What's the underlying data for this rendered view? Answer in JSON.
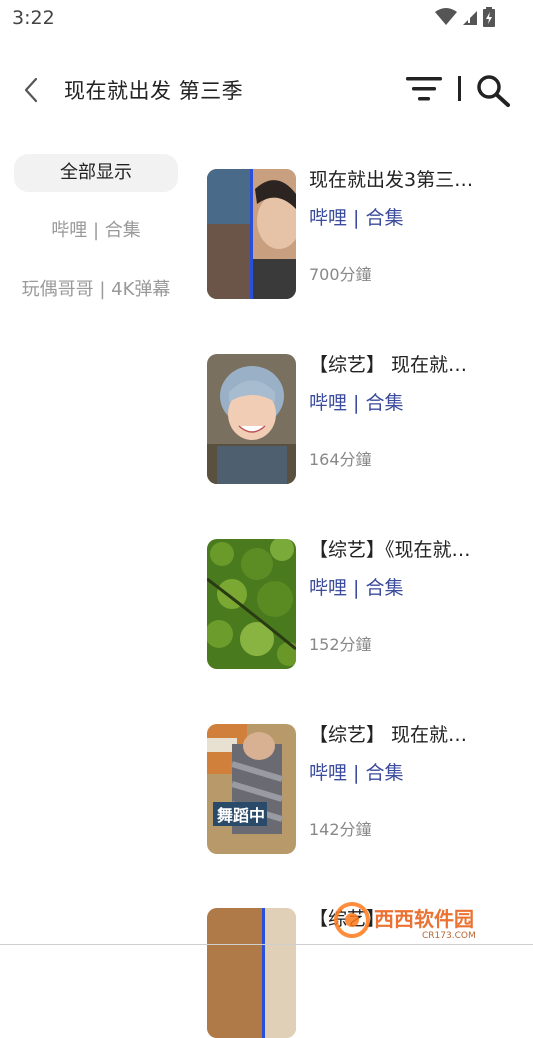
{
  "status": {
    "time": "3:22"
  },
  "header": {
    "title": "现在就出发 第三季"
  },
  "sidebar": {
    "items": [
      {
        "label": "全部显示",
        "active": true
      },
      {
        "label": "哔哩 | 合集",
        "active": false
      },
      {
        "label": "玩偶哥哥 | 4K弹幕",
        "active": false
      }
    ]
  },
  "results": [
    {
      "title": "现在就出发3第三…",
      "source": "哔哩 | 合集",
      "duration": "700分鐘"
    },
    {
      "title": "【综艺】 现在就…",
      "source": "哔哩 | 合集",
      "duration": "164分鐘"
    },
    {
      "title": "【综艺】《现在就…",
      "source": "哔哩 | 合集",
      "duration": "152分鐘"
    },
    {
      "title": "【综艺】 现在就…",
      "source": "哔哩 | 合集",
      "duration": "142分鐘"
    },
    {
      "title": "【综艺】",
      "source": "",
      "duration": ""
    }
  ],
  "thumb_texts": {
    "dance_caption": "舞蹈中"
  },
  "watermark": {
    "text": "西西软件园",
    "site": "CR173.COM"
  },
  "colors": {
    "accent": "#3c4c9c",
    "active_bg": "#f2f2f2",
    "muted": "#999999"
  }
}
